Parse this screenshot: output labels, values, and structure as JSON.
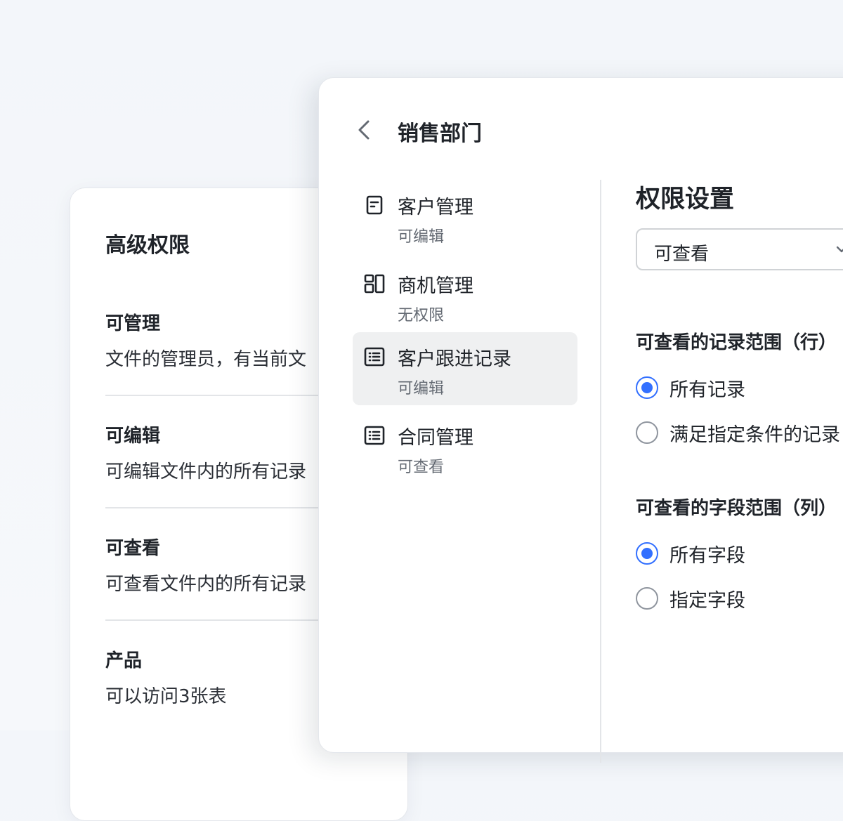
{
  "advanced": {
    "title": "高级权限",
    "items": [
      {
        "name": "可管理",
        "desc": "文件的管理员，有当前文"
      },
      {
        "name": "可编辑",
        "desc": "可编辑文件内的所有记录"
      },
      {
        "name": "可查看",
        "desc": "可查看文件内的所有记录"
      },
      {
        "name": "产品",
        "desc": "可以访问3张表"
      }
    ]
  },
  "panel": {
    "title": "销售部门",
    "tables": [
      {
        "name": "客户管理",
        "perm": "可编辑",
        "icon": "document-icon"
      },
      {
        "name": "商机管理",
        "perm": "无权限",
        "icon": "kanban-icon"
      },
      {
        "name": "客户跟进记录",
        "perm": "可编辑",
        "icon": "list-icon",
        "selected": true
      },
      {
        "name": "合同管理",
        "perm": "可查看",
        "icon": "list-icon"
      }
    ],
    "settings": {
      "title": "权限设置",
      "select_value": "可查看",
      "row_scope_label": "可查看的记录范围（行）",
      "row_options": [
        "所有记录",
        "满足指定条件的记录"
      ],
      "col_scope_label": "可查看的字段范围（列）",
      "col_options": [
        "所有字段",
        "指定字段"
      ]
    }
  },
  "colors": {
    "accent": "#3370ff",
    "selected_bg": "#eff0f1"
  }
}
